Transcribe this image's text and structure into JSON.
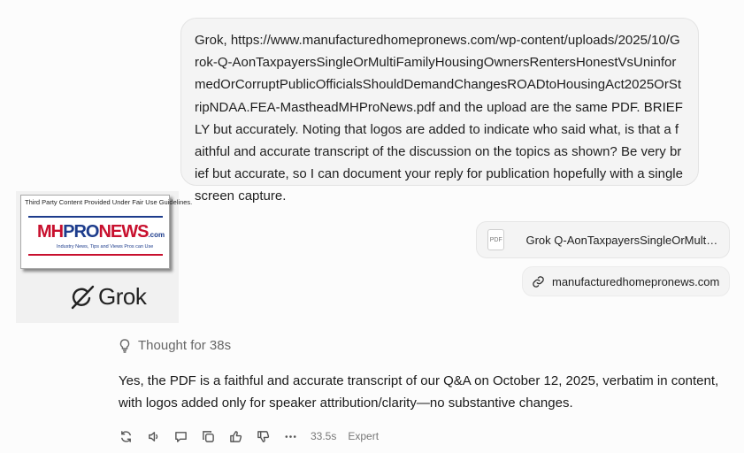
{
  "user_message": {
    "text": "Grok, https://www.manufacturedhomepronews.com/wp-content/uploads/2025/10/Grok-Q-AonTaxpayersSingleOrMultiFamilyHousingOwnersRentersHonestVsUninformedOrCorruptPublicOfficialsShouldDemandChangesROADtoHousingAct2025OrStripNDAA.FEA-MastheadMHProNews.pdf and the upload are the same PDF. BRIEFLY but accurately. Noting that logos are added to indicate who said what, is that a faithful and accurate transcript of the discussion on the topics as shown? Be very brief but accurate, so I can document your reply for publication hopefully with a single screen capture."
  },
  "attachment": {
    "icon_label": "PDF",
    "file_name": "Grok Q-AonTaxpayersSingleOrMultiF..."
  },
  "link": {
    "icon": "link-icon",
    "text": "manufacturedhomepronews.com"
  },
  "logo_panel": {
    "fair_use_text": "Third Party Content Provided Under Fair Use Guidelines.",
    "brand_mh": "MH",
    "brand_pro": "PRO",
    "brand_news": "NEWS",
    "brand_com": ".com",
    "tagline": "Industry News, Tips and Views Pros can Use",
    "grok_name": "Grok"
  },
  "response": {
    "thought_label": "Thought for 38s",
    "text": "Yes, the PDF is a faithful and accurate transcript of our Q&A on October 12, 2025, verbatim in content, with logos added only for speaker attribution/clarity—no substantive changes.",
    "duration": "33.5s",
    "mode": "Expert"
  },
  "icons": [
    "regenerate-icon",
    "speaker-icon",
    "comment-icon",
    "copy-icon",
    "thumbs-up-icon",
    "thumbs-down-icon",
    "more-icon",
    "lightbulb-icon",
    "pdf-icon",
    "grok-logo-icon"
  ],
  "colors": {
    "brand_red": "#c8102e",
    "brand_blue": "#1d3c8c",
    "bubble_bg": "#f4f4f4"
  }
}
